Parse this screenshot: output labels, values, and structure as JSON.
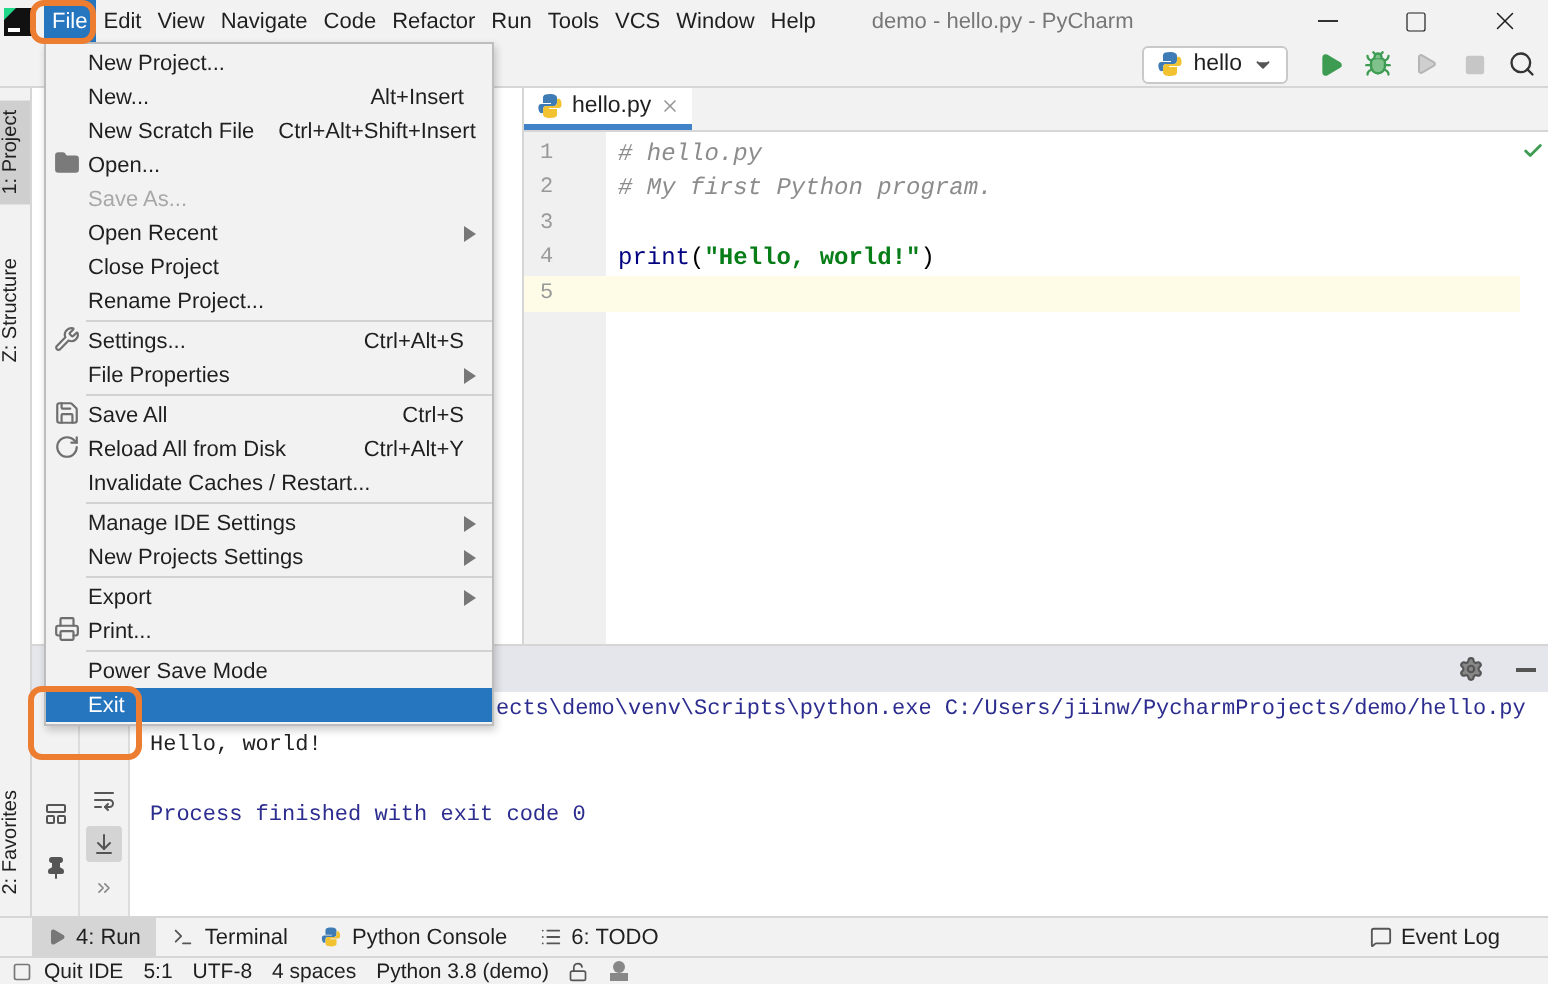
{
  "window": {
    "title": "demo - hello.py - PyCharm"
  },
  "menu_bar": [
    {
      "label": "File",
      "selected": true,
      "highlighted": true
    },
    {
      "label": "Edit",
      "selected": false,
      "highlighted": false
    },
    {
      "label": "View",
      "selected": false,
      "highlighted": false
    },
    {
      "label": "Navigate",
      "selected": false,
      "highlighted": false
    },
    {
      "label": "Code",
      "selected": false,
      "highlighted": false
    },
    {
      "label": "Refactor",
      "selected": false,
      "highlighted": false
    },
    {
      "label": "Run",
      "selected": false,
      "highlighted": false
    },
    {
      "label": "Tools",
      "selected": false,
      "highlighted": false
    },
    {
      "label": "VCS",
      "selected": false,
      "highlighted": false
    },
    {
      "label": "Window",
      "selected": false,
      "highlighted": false
    },
    {
      "label": "Help",
      "selected": false,
      "highlighted": false
    }
  ],
  "file_menu": [
    {
      "kind": "item",
      "label": "New Project...",
      "disabled": false,
      "submenu": false,
      "selected": false,
      "highlighted": false
    },
    {
      "kind": "item",
      "label": "New...",
      "shortcut": "Alt+Insert",
      "disabled": false,
      "submenu": false,
      "selected": false,
      "highlighted": false
    },
    {
      "kind": "item",
      "label": "New Scratch File",
      "shortcut": "Ctrl+Alt+Shift+Insert",
      "disabled": false,
      "submenu": false,
      "selected": false,
      "highlighted": false
    },
    {
      "kind": "item",
      "label": "Open...",
      "disabled": false,
      "submenu": false,
      "selected": false,
      "highlighted": false
    },
    {
      "kind": "item",
      "label": "Save As...",
      "disabled": true,
      "submenu": false,
      "selected": false,
      "highlighted": false
    },
    {
      "kind": "item",
      "label": "Open Recent",
      "disabled": false,
      "submenu": true,
      "selected": false,
      "highlighted": false
    },
    {
      "kind": "item",
      "label": "Close Project",
      "disabled": false,
      "submenu": false,
      "selected": false,
      "highlighted": false
    },
    {
      "kind": "item",
      "label": "Rename Project...",
      "disabled": false,
      "submenu": false,
      "selected": false,
      "highlighted": false
    },
    {
      "kind": "separator"
    },
    {
      "kind": "item",
      "label": "Settings...",
      "shortcut": "Ctrl+Alt+S",
      "disabled": false,
      "submenu": false,
      "selected": false,
      "highlighted": false
    },
    {
      "kind": "item",
      "label": "File Properties",
      "disabled": false,
      "submenu": true,
      "selected": false,
      "highlighted": false
    },
    {
      "kind": "separator"
    },
    {
      "kind": "item",
      "label": "Save All",
      "shortcut": "Ctrl+S",
      "disabled": false,
      "submenu": false,
      "selected": false,
      "highlighted": false
    },
    {
      "kind": "item",
      "label": "Reload All from Disk",
      "shortcut": "Ctrl+Alt+Y",
      "disabled": false,
      "submenu": false,
      "selected": false,
      "highlighted": false
    },
    {
      "kind": "item",
      "label": "Invalidate Caches / Restart...",
      "disabled": false,
      "submenu": false,
      "selected": false,
      "highlighted": false
    },
    {
      "kind": "separator"
    },
    {
      "kind": "item",
      "label": "Manage IDE Settings",
      "disabled": false,
      "submenu": true,
      "selected": false,
      "highlighted": false
    },
    {
      "kind": "item",
      "label": "New Projects Settings",
      "disabled": false,
      "submenu": true,
      "selected": false,
      "highlighted": false
    },
    {
      "kind": "separator"
    },
    {
      "kind": "item",
      "label": "Export",
      "disabled": false,
      "submenu": true,
      "selected": false,
      "highlighted": false
    },
    {
      "kind": "item",
      "label": "Print...",
      "disabled": false,
      "submenu": false,
      "selected": false,
      "highlighted": false
    },
    {
      "kind": "separator"
    },
    {
      "kind": "item",
      "label": "Power Save Mode",
      "disabled": false,
      "submenu": false,
      "selected": false,
      "highlighted": false
    },
    {
      "kind": "item",
      "label": "Exit",
      "disabled": false,
      "submenu": false,
      "selected": true,
      "highlighted": true
    }
  ],
  "run_configuration": {
    "label": "hello"
  },
  "tool_strip": [
    {
      "label": "1: Project",
      "selected": true
    },
    {
      "label": "Z: Structure",
      "selected": false
    },
    {
      "label": "2: Favorites",
      "selected": false
    }
  ],
  "editor": {
    "tabs": [
      {
        "label": "hello.py",
        "selected": true
      }
    ],
    "lines": [
      {
        "number": "1",
        "current": false,
        "segments": [
          {
            "kind": "comment",
            "text": "# hello.py"
          }
        ]
      },
      {
        "number": "2",
        "current": false,
        "segments": [
          {
            "kind": "comment",
            "text": "# My first Python program."
          }
        ]
      },
      {
        "number": "3",
        "current": false
      },
      {
        "number": "4",
        "current": false,
        "segments": [
          {
            "kind": "builtin",
            "text": "print"
          },
          {
            "kind": "plain",
            "text": "("
          },
          {
            "kind": "string",
            "text": "\"Hello, world!\""
          },
          {
            "kind": "plain",
            "text": ")"
          }
        ]
      },
      {
        "number": "5",
        "current": true
      }
    ]
  },
  "console": [
    {
      "kind": "command",
      "text": "ects\\demo\\venv\\Scripts\\python.exe C:/Users/jiinw/PycharmProjects/demo/hello.py"
    },
    {
      "kind": "output",
      "text": "Hello, world!"
    },
    {
      "kind": "exit",
      "text": "Process finished with exit code 0"
    }
  ],
  "bottom_tabs": [
    {
      "label": "4: Run",
      "selected": true
    },
    {
      "label": "Terminal",
      "selected": false
    },
    {
      "label": "Python Console",
      "selected": false
    },
    {
      "label": "6: TODO",
      "selected": false
    }
  ],
  "event_log": "Event Log",
  "status_bar": {
    "message": "Quit IDE",
    "items": [
      "5:1",
      "UTF-8",
      "4 spaces",
      "Python 3.8 (demo)"
    ]
  }
}
